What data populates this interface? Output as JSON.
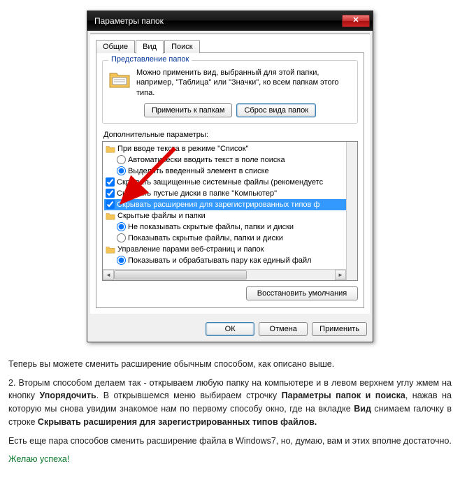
{
  "dialog": {
    "title": "Параметры папок",
    "close": "✕",
    "tabs": {
      "general": "Общие",
      "view": "Вид",
      "search": "Поиск"
    },
    "folderViews": {
      "title": "Представление папок",
      "text": "Можно применить вид, выбранный для этой папки, например, \"Таблица\" или \"Значки\", ко всем папкам этого типа.",
      "applyBtn": "Применить к папкам",
      "resetBtn": "Сброс вида папок"
    },
    "advanced": {
      "label": "Дополнительные параметры:",
      "items": [
        {
          "type": "folder",
          "indent": 0,
          "text": "При вводе текста в режиме \"Список\""
        },
        {
          "type": "radio",
          "indent": 1,
          "checked": false,
          "text": "Автоматически вводить текст в поле поиска"
        },
        {
          "type": "radio",
          "indent": 1,
          "checked": true,
          "text": "Выделять введенный элемент в списке"
        },
        {
          "type": "check",
          "indent": 0,
          "checked": true,
          "text": "Скрывать защищенные системные файлы (рекомендуетс"
        },
        {
          "type": "check",
          "indent": 0,
          "checked": true,
          "text": "Скрывать пустые диски в папке \"Компьютер\""
        },
        {
          "type": "check",
          "indent": 0,
          "checked": true,
          "selected": true,
          "text": "Скрывать расширения для зарегистрированных типов ф"
        },
        {
          "type": "folder",
          "indent": 0,
          "text": "Скрытые файлы и папки"
        },
        {
          "type": "radio",
          "indent": 1,
          "checked": true,
          "text": "Не показывать скрытые файлы, папки и диски"
        },
        {
          "type": "radio",
          "indent": 1,
          "checked": false,
          "text": "Показывать скрытые файлы, папки и диски"
        },
        {
          "type": "folder",
          "indent": 0,
          "text": "Управление парами веб-страниц и папок"
        },
        {
          "type": "radio",
          "indent": 1,
          "checked": true,
          "text": "Показывать и обрабатывать пару как единый файл"
        }
      ],
      "restoreBtn": "Восстановить умолчания"
    },
    "footer": {
      "ok": "ОК",
      "cancel": "Отмена",
      "apply": "Применить"
    }
  },
  "article": {
    "p1": "Теперь вы можете сменить расширение обычным способом, как описано выше.",
    "p2_a": "2. Вторым способом делаем так - открываем любую папку на компьютере и в левом верхнем углу жмем на кнопку ",
    "p2_b": "Упорядочить",
    "p2_c": ". В открывшемся меню выбираем строчку ",
    "p2_d": "Параметры папок и поиска",
    "p2_e": ", нажав на которую мы снова увидим знакомое нам по первому способу окно, где на вкладке ",
    "p2_f": "Вид",
    "p2_g": " снимаем галочку в строке ",
    "p2_h": "Скрывать расширения для зарегистрированных типов файлов.",
    "p3": "Есть еще пара способов сменить расширение файла в Windows7, но, думаю, вам и этих вполне достаточно.",
    "p4": "Желаю успеха!"
  }
}
